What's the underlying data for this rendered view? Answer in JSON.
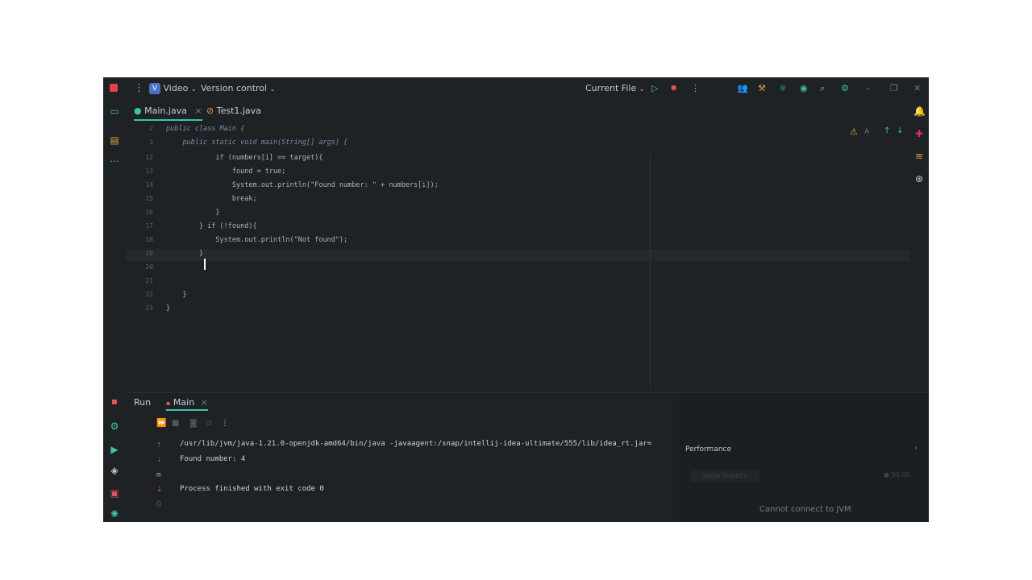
{
  "titlebar": {
    "project_badge": "V",
    "project_name": "Video",
    "vcs": "Version control",
    "run_config": "Current File"
  },
  "tabs": [
    {
      "label": "Main.java",
      "icon": "java-class-icon",
      "active": true
    },
    {
      "label": "Test1.java",
      "icon": "java-test-icon",
      "active": false
    }
  ],
  "editor": {
    "line_numbers": [
      "2",
      "3",
      "12",
      "13",
      "14",
      "15",
      "16",
      "17",
      "18",
      "19",
      "20",
      "21",
      "22",
      "23"
    ],
    "lines": [
      "public class Main {",
      "    public static void main(String[] args) {",
      "            if (numbers[i] == target){",
      "                found = true;",
      "                System.out.println(\"Found number: \" + numbers[i]);",
      "                break;",
      "            }",
      "        } if (!found){",
      "            System.out.println(\"Not found\");",
      "        }",
      "",
      "",
      "    }",
      "}"
    ]
  },
  "run": {
    "tab_run": "Run",
    "tab_main": "Main",
    "console": [
      "/usr/lib/jvm/java-1.21.0-openjdk-amd64/bin/java -javaagent:/snap/intellij-idea-ultimate/555/lib/idea_rt.jar=",
      "Found number: 4",
      "",
      "Process finished with exit code 0"
    ],
    "performance_title": "Performance",
    "show_results": "SHOW RESULTS",
    "timer": "00:00",
    "cannot_connect": "Cannot connect to JVM"
  },
  "colors": {
    "background": "#1e2225",
    "accent": "#3dc2b0",
    "run_green": "#4ec07a",
    "stop_red": "#e05555"
  }
}
